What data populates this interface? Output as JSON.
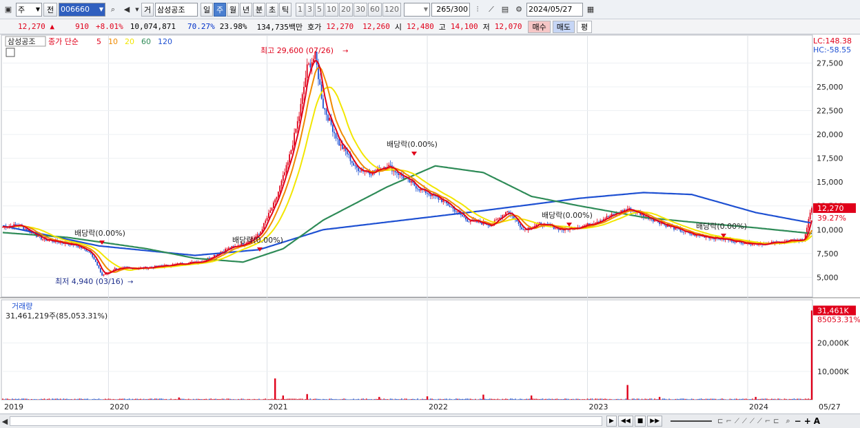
{
  "toolbar": {
    "market_select": "주",
    "prefix_label": "전",
    "code": "006660",
    "exchange_label": "거",
    "stock_name": "삼성공조",
    "period_tabs": [
      "일",
      "주",
      "월",
      "년",
      "분",
      "초",
      "틱"
    ],
    "selected_period": "주",
    "interval_buttons": [
      "1",
      "3",
      "5",
      "10",
      "20",
      "30",
      "60",
      "120"
    ],
    "count_display": "265",
    "count_total": "/300",
    "date": "2024/05/27"
  },
  "quote": {
    "price": "12,270",
    "direction_icon": "▲",
    "change": "910",
    "change_pct": "+8.01%",
    "volume": "10,074,871",
    "vol_ratio": "70.27%",
    "turnover": "23.98%",
    "trade_value": "134,735백만",
    "bid_label": "호가",
    "ask_price": "12,270",
    "bid_price": "12,260",
    "open_label": "시",
    "open": "12,480",
    "high_label": "고",
    "high": "14,100",
    "low_label": "저",
    "low": "12,070",
    "buy_label": "매수",
    "sell_label": "매도",
    "avg_label": "평"
  },
  "legend": {
    "name": "삼성공조",
    "ma_title": "종가 단순",
    "ma_periods": [
      "5",
      "10",
      "20",
      "60",
      "120"
    ],
    "ma_colors": [
      "#e0001a",
      "#f08a00",
      "#f2e600",
      "#2e8b57",
      "#1e50d2"
    ]
  },
  "chart_data": {
    "type": "candlestick",
    "x_labels": [
      "2019",
      "2020",
      "2021",
      "2022",
      "2023",
      "2024",
      "05/27"
    ],
    "price_ticks": [
      27500,
      25000,
      22500,
      20000,
      17500,
      15000,
      12500,
      10000,
      7500,
      5000
    ],
    "price_tick_labels": [
      "27,500",
      "25,000",
      "22,500",
      "20,000",
      "17,500",
      "15,000",
      "12,500",
      "10,000",
      "7,500",
      "5,000"
    ],
    "y_range": [
      3000,
      30500
    ],
    "lc_label": "LC:148.38",
    "hc_label": "HC:-58.55",
    "current_price_label": "12,270",
    "current_pct_label": "39.27%",
    "high_annotation": "최고 29,600 (07/26)",
    "low_annotation": "최저 4,940 (03/16)",
    "dividend_markers": [
      "배당락(0.00%)",
      "배당락(0.00%)",
      "배당락(0.00%)",
      "배당락(0.00%)",
      "배당락(0.00%)"
    ],
    "close_keyframes": [
      [
        0,
        10300
      ],
      [
        10,
        10500
      ],
      [
        25,
        9000
      ],
      [
        45,
        8400
      ],
      [
        55,
        7600
      ],
      [
        62,
        5200
      ],
      [
        70,
        5900
      ],
      [
        90,
        6000
      ],
      [
        110,
        6400
      ],
      [
        125,
        6700
      ],
      [
        140,
        8000
      ],
      [
        150,
        8500
      ],
      [
        160,
        9500
      ],
      [
        170,
        13000
      ],
      [
        178,
        17000
      ],
      [
        185,
        22000
      ],
      [
        190,
        27000
      ],
      [
        195,
        28200
      ],
      [
        200,
        23000
      ],
      [
        205,
        21000
      ],
      [
        210,
        19000
      ],
      [
        215,
        18000
      ],
      [
        220,
        16500
      ],
      [
        230,
        16000
      ],
      [
        240,
        16800
      ],
      [
        250,
        15500
      ],
      [
        260,
        14300
      ],
      [
        275,
        13000
      ],
      [
        290,
        11000
      ],
      [
        305,
        10500
      ],
      [
        315,
        12000
      ],
      [
        325,
        10000
      ],
      [
        335,
        10600
      ],
      [
        350,
        10000
      ],
      [
        365,
        10500
      ],
      [
        380,
        11500
      ],
      [
        390,
        12200
      ],
      [
        400,
        11500
      ],
      [
        415,
        10400
      ],
      [
        430,
        9500
      ],
      [
        450,
        9000
      ],
      [
        465,
        8600
      ],
      [
        475,
        8500
      ],
      [
        490,
        8800
      ],
      [
        500,
        8950
      ],
      [
        505,
        12270
      ]
    ],
    "ma60_keyframes": [
      [
        0,
        9700
      ],
      [
        40,
        9200
      ],
      [
        90,
        8000
      ],
      [
        120,
        7000
      ],
      [
        150,
        6600
      ],
      [
        175,
        8000
      ],
      [
        200,
        11000
      ],
      [
        240,
        14500
      ],
      [
        270,
        16700
      ],
      [
        300,
        16000
      ],
      [
        330,
        13500
      ],
      [
        360,
        12500
      ],
      [
        400,
        11300
      ],
      [
        430,
        10800
      ],
      [
        470,
        10200
      ],
      [
        505,
        9600
      ]
    ],
    "ma120_keyframes": [
      [
        0,
        10400
      ],
      [
        60,
        8300
      ],
      [
        120,
        7300
      ],
      [
        160,
        7900
      ],
      [
        200,
        10000
      ],
      [
        250,
        11000
      ],
      [
        300,
        12000
      ],
      [
        360,
        13300
      ],
      [
        400,
        13900
      ],
      [
        430,
        13700
      ],
      [
        470,
        11800
      ],
      [
        505,
        10700
      ]
    ],
    "volume_panel": {
      "label": "거래량",
      "current_text": "31,461,219주(85,053.31%)",
      "current_value_label": "31,461K",
      "current_pct_label": "85053.31%",
      "axis_ticks": [
        "20,000K",
        "10,000K"
      ],
      "spikes": [
        [
          110,
          0.8
        ],
        [
          170,
          7.5
        ],
        [
          175,
          1.5
        ],
        [
          190,
          2.0
        ],
        [
          235,
          1.0
        ],
        [
          265,
          1.2
        ],
        [
          300,
          1.8
        ],
        [
          330,
          1.5
        ],
        [
          390,
          5.2
        ],
        [
          410,
          1.0
        ],
        [
          470,
          1.0
        ],
        [
          505,
          31.46
        ]
      ]
    }
  },
  "bottom": {
    "controls": [
      "▶",
      "◀◀",
      "■",
      "▶▶"
    ],
    "zoom": [
      "−",
      "+",
      "A"
    ]
  }
}
